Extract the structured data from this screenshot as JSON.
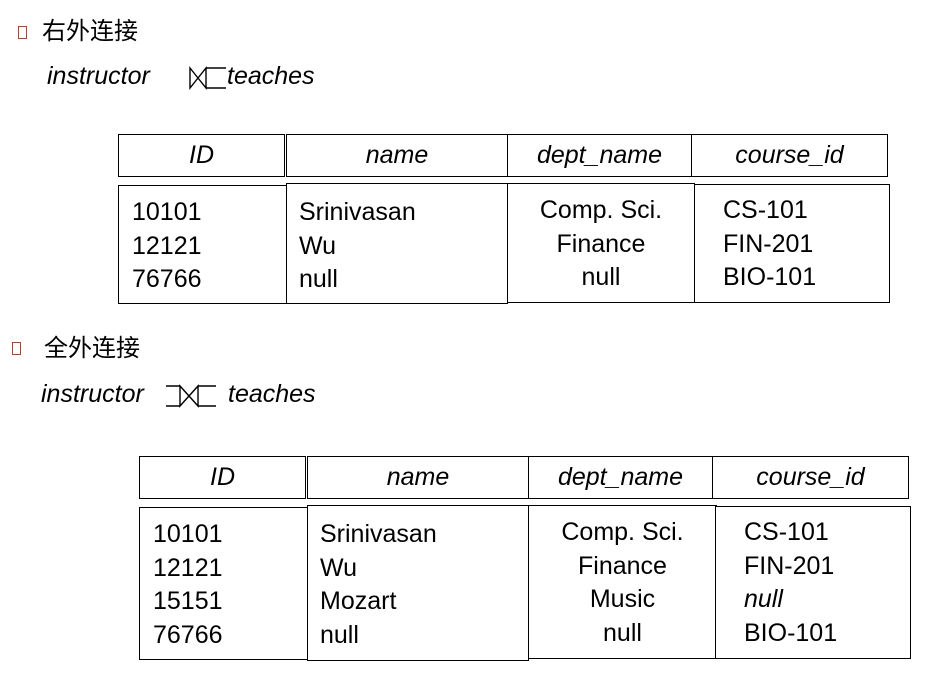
{
  "section1": {
    "heading": "右外连接",
    "left_operand": "instructor",
    "right_operand": "teaches",
    "operator": "right-outer-join-symbol",
    "headers": [
      "ID",
      "name",
      "dept_name",
      "course_id"
    ],
    "columns": {
      "id": [
        "10101",
        "12121",
        "76766"
      ],
      "name": [
        "Srinivasan",
        "Wu",
        "null"
      ],
      "dept_name": [
        "Comp. Sci.",
        "Finance",
        "null"
      ],
      "course_id": [
        "CS-101",
        "FIN-201",
        "BIO-101"
      ]
    }
  },
  "section2": {
    "heading": "全外连接",
    "left_operand": "instructor",
    "right_operand": "teaches",
    "operator": "full-outer-join-symbol",
    "headers": [
      "ID",
      "name",
      "dept_name",
      "course_id"
    ],
    "columns": {
      "id": [
        "10101",
        "12121",
        "15151",
        "76766"
      ],
      "name": [
        "Srinivasan",
        "Wu",
        "Mozart",
        "null"
      ],
      "dept_name": [
        "Comp. Sci.",
        "Finance",
        "Music",
        "null"
      ],
      "course_id": [
        "CS-101",
        "FIN-201",
        "null",
        "BIO-101"
      ]
    }
  },
  "colors": {
    "bullet": "#c0392b",
    "text": "#000000"
  },
  "bullet_icon": "hollow-square-bullet-icon"
}
